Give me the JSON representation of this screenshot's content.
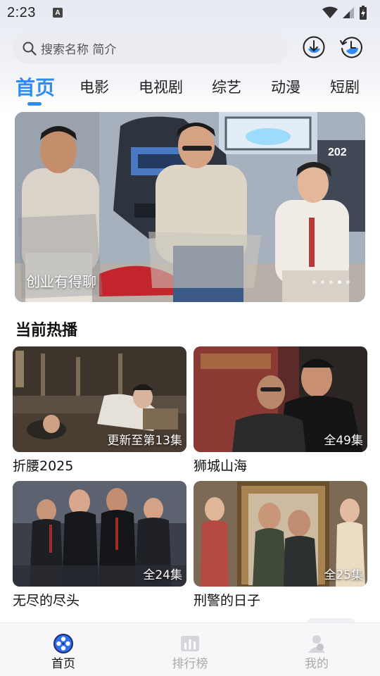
{
  "status_bar": {
    "time": "2:23",
    "notification_icon": "A"
  },
  "search": {
    "placeholder": "搜索名称 简介"
  },
  "header_icons": [
    "download-icon",
    "history-icon"
  ],
  "tabs": [
    {
      "label": "首页",
      "active": true
    },
    {
      "label": "电影",
      "active": false
    },
    {
      "label": "电视剧",
      "active": false
    },
    {
      "label": "综艺",
      "active": false
    },
    {
      "label": "动漫",
      "active": false
    },
    {
      "label": "短剧",
      "active": false
    }
  ],
  "banner": {
    "caption": "创业有得聊",
    "corner_text": "202"
  },
  "section": {
    "title": "当前热播"
  },
  "cards": [
    {
      "title": "折腰2025",
      "badge": "更新至第13集"
    },
    {
      "title": "狮城山海",
      "badge": "全49集"
    },
    {
      "title": "无尽的尽头",
      "badge": "全24集"
    },
    {
      "title": "刑警的日子",
      "badge": "全25集"
    }
  ],
  "bottom_nav": [
    {
      "label": "首页",
      "active": true
    },
    {
      "label": "排行榜",
      "active": false
    },
    {
      "label": "我的",
      "active": false
    }
  ],
  "colors": {
    "accent": "#2f8cf0",
    "inactive_nav": "#aaaaaa"
  }
}
